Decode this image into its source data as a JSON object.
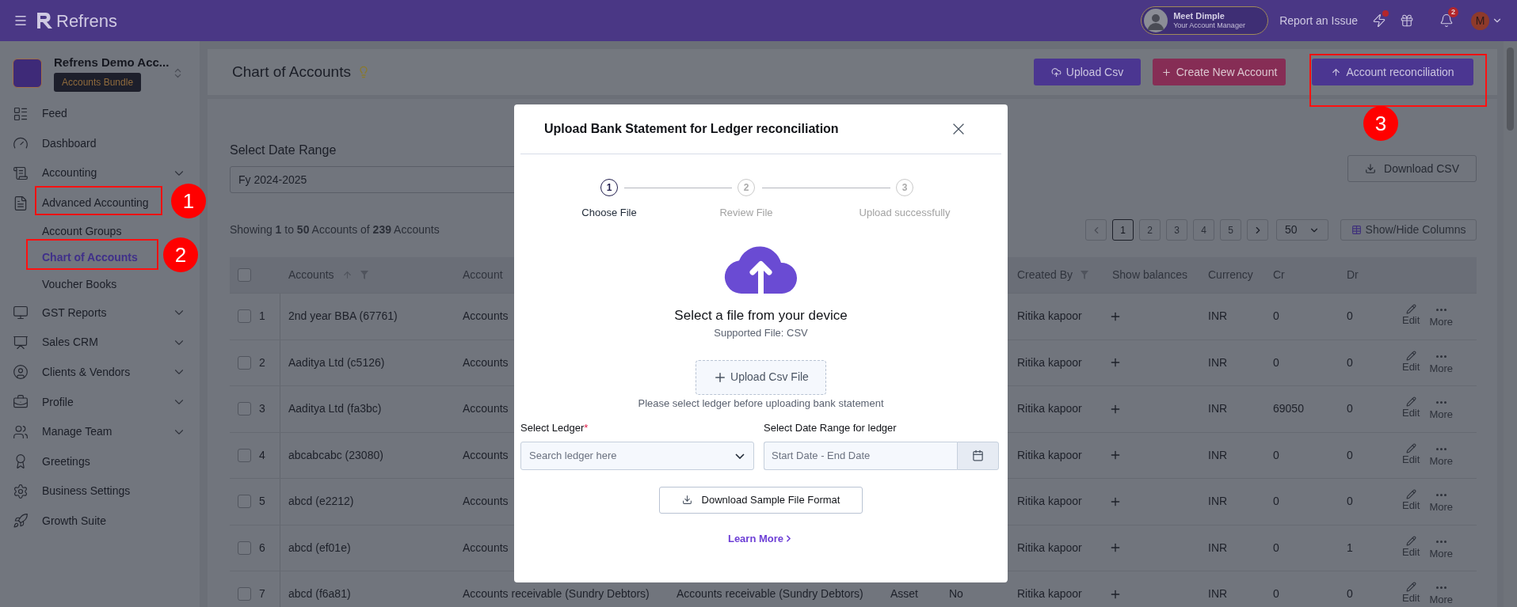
{
  "topbar": {
    "brand": "Refrens",
    "manager": {
      "title": "Meet Dimple",
      "subtitle": "Your Account Manager"
    },
    "report_link": "Report an Issue",
    "notifications_count": "2",
    "user_initial": "M"
  },
  "sidebar": {
    "org": {
      "name": "Refrens Demo Acc...",
      "badge": "Accounts Bundle"
    },
    "items": [
      {
        "label": "Feed",
        "kind": "link",
        "selected": false
      },
      {
        "label": "Dashboard",
        "kind": "link",
        "selected": false
      },
      {
        "label": "Accounting",
        "kind": "group",
        "selected": false
      },
      {
        "label": "Advanced Accounting",
        "kind": "link",
        "selected": false,
        "children": [
          {
            "label": "Account Groups",
            "selected": false
          },
          {
            "label": "Chart of Accounts",
            "selected": true
          },
          {
            "label": "Voucher Books",
            "selected": false
          }
        ]
      },
      {
        "label": "GST Reports",
        "kind": "group",
        "selected": false
      },
      {
        "label": "Sales CRM",
        "kind": "group",
        "selected": false
      },
      {
        "label": "Clients & Vendors",
        "kind": "group",
        "selected": false
      },
      {
        "label": "Profile",
        "kind": "group",
        "selected": false
      },
      {
        "label": "Manage Team",
        "kind": "group",
        "selected": false
      },
      {
        "label": "Greetings",
        "kind": "link",
        "selected": false
      },
      {
        "label": "Business Settings",
        "kind": "link",
        "selected": false
      },
      {
        "label": "Growth Suite",
        "kind": "link",
        "selected": false
      }
    ]
  },
  "page": {
    "title": "Chart of Accounts",
    "actions": [
      {
        "label": "Upload Csv",
        "kind": "upload"
      },
      {
        "label": "Create New Account",
        "kind": "create"
      },
      {
        "label": "Account reconciliation",
        "kind": "reconcile"
      }
    ]
  },
  "filters": {
    "date_range_label": "Select Date Range",
    "date_range_value": "Fy 2024-2025",
    "download": "Download CSV"
  },
  "summary": "Showing **1** to **50** Accounts of **239** Accounts",
  "pagination": {
    "pages": [
      {
        "label": "1",
        "selected": true
      },
      {
        "label": "2",
        "selected": false
      },
      {
        "label": "3",
        "selected": false
      },
      {
        "label": "4",
        "selected": false
      },
      {
        "label": "5",
        "selected": false
      }
    ],
    "page_size": "50",
    "columns_button": "Show/Hide Columns"
  },
  "table": {
    "all_checked": false,
    "columns": [
      {
        "label": "Accounts"
      },
      {
        "label": "Account"
      },
      {
        "label": "Created By"
      },
      {
        "label": "Show balances"
      },
      {
        "label": "Currency"
      },
      {
        "label": "Cr"
      },
      {
        "label": "Dr"
      }
    ],
    "rows": [
      {
        "checked": false,
        "number": "1",
        "account": "2nd year BBA (67761)",
        "account_group": "Accounts",
        "created_by": "Ritika kapoor",
        "currency": "INR",
        "cr": "0",
        "dr": "0",
        "actions": [
          "Edit",
          "More"
        ]
      },
      {
        "checked": false,
        "number": "2",
        "account": "Aaditya Ltd (c5126)",
        "account_group": "Accounts",
        "created_by": "Ritika kapoor",
        "currency": "INR",
        "cr": "0",
        "dr": "0",
        "actions": [
          "Edit",
          "More"
        ]
      },
      {
        "checked": false,
        "number": "3",
        "account": "Aaditya Ltd (fa3bc)",
        "account_group": "Accounts",
        "created_by": "Ritika kapoor",
        "currency": "INR",
        "cr": "69050",
        "dr": "0",
        "actions": [
          "Edit",
          "More"
        ]
      },
      {
        "checked": false,
        "number": "4",
        "account": "abcabcabc (23080)",
        "account_group": "Accounts",
        "created_by": "Ritika kapoor",
        "currency": "INR",
        "cr": "0",
        "dr": "0",
        "actions": [
          "Edit",
          "More"
        ]
      },
      {
        "checked": false,
        "number": "5",
        "account": "abcd (e2212)",
        "account_group": "Accounts",
        "created_by": "Ritika kapoor",
        "currency": "INR",
        "cr": "0",
        "dr": "0",
        "actions": [
          "Edit",
          "More"
        ]
      },
      {
        "checked": false,
        "number": "6",
        "account": "abcd (ef01e)",
        "account_group": "Accounts",
        "created_by": "Ritika kapoor",
        "currency": "INR",
        "cr": "0",
        "dr": "1",
        "actions": [
          "Edit",
          "More"
        ]
      },
      {
        "checked": false,
        "number": "7",
        "account": "abcd (f6a81)",
        "account_group": "Accounts receivable (Sundry Debtors)",
        "column_4": "Accounts receivable (Sundry Debtors)",
        "column_5": "Asset",
        "column_6": "No",
        "created_by": "Ritika kapoor",
        "currency": "INR",
        "cr": "0",
        "dr": "0",
        "actions": [
          "Edit",
          "More"
        ]
      }
    ]
  },
  "modal": {
    "title": "Upload Bank Statement for Ledger reconciliation",
    "steps": [
      {
        "number": "1",
        "label": "Choose File",
        "selected": true
      },
      {
        "number": "2",
        "label": "Review File",
        "selected": false
      },
      {
        "number": "3",
        "label": "Upload successfully",
        "selected": false
      }
    ],
    "prompt": "Select a file from your device",
    "supported": "Supported File: CSV",
    "upload_button": "Upload Csv File",
    "hint": "Please select ledger before uploading bank statement",
    "ledger": {
      "label": "Select Ledger",
      "required_mark": "*",
      "placeholder": "Search ledger here"
    },
    "date_range": {
      "label": "Select Date Range for ledger",
      "placeholder": "Start Date - End Date"
    },
    "sample_button": "Download Sample File Format",
    "learn_more": "Learn More"
  },
  "annotations": [
    {
      "label": "1"
    },
    {
      "label": "2"
    },
    {
      "label": "3"
    }
  ]
}
